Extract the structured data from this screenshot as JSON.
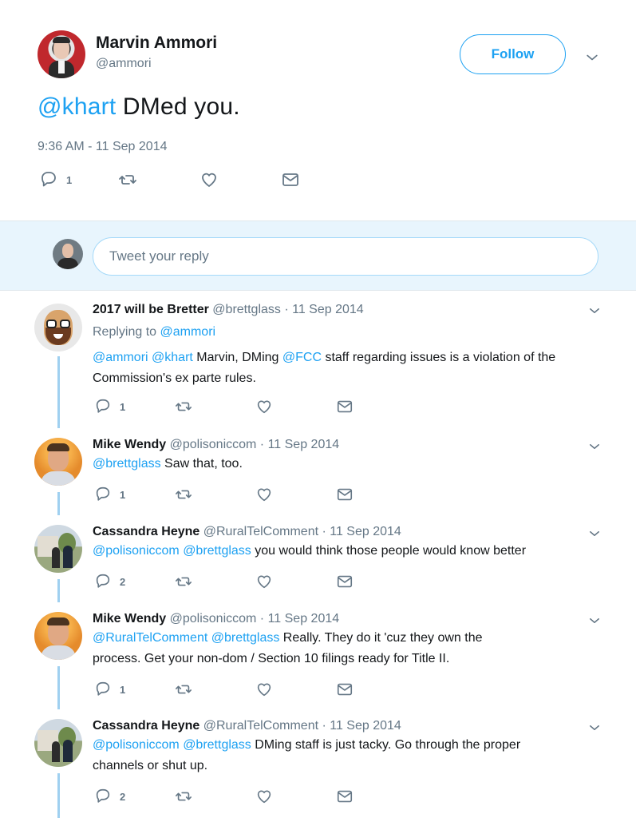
{
  "main_tweet": {
    "author_name": "Marvin Ammori",
    "author_handle": "@ammori",
    "follow_label": "Follow",
    "text_mention": "@khart",
    "text_rest": " DMed you.",
    "timestamp": "9:36 AM - 11 Sep 2014",
    "reply_count": "1"
  },
  "reply_box": {
    "placeholder": "Tweet your reply"
  },
  "colors": {
    "accent": "#1da1f2",
    "muted": "#657786",
    "reply_bg": "#e8f5fd",
    "thread_line": "#9fd0f0"
  },
  "icons": [
    "reply-icon",
    "retweet-icon",
    "like-icon",
    "dm-icon",
    "chevron-down-icon"
  ],
  "replies": [
    {
      "name": "2017 will be Bretter",
      "handle_date": "@brettglass · 11 Sep 2014",
      "replying_prefix": "Replying to ",
      "replying_to": "@ammori",
      "m1": "@ammori",
      "m2": "@khart",
      "t1": " Marvin, DMing ",
      "m3": "@FCC",
      "t2": " staff regarding issues is a violation of the",
      "line2": "Commission's ex parte rules.",
      "reply_count": "1"
    },
    {
      "name": "Mike Wendy",
      "handle_date": "@polisoniccom · 11 Sep 2014",
      "m1": "@brettglass",
      "t1": " Saw that, too.",
      "reply_count": "1"
    },
    {
      "name": "Cassandra Heyne",
      "handle_date": "@RuralTelComment · 11 Sep 2014",
      "m1": "@polisoniccom",
      "m2": "@brettglass",
      "t1": " you would think those people would know better",
      "reply_count": "2"
    },
    {
      "name": "Mike Wendy",
      "handle_date": "@polisoniccom · 11 Sep 2014",
      "m1": "@RuralTelComment",
      "m2": "@brettglass",
      "t1": " Really.  They do it 'cuz they own the",
      "line2": "process.  Get your non-dom / Section 10 filings ready for Title II.",
      "reply_count": "1"
    },
    {
      "name": "Cassandra Heyne",
      "handle_date": "@RuralTelComment · 11 Sep 2014",
      "m1": "@polisoniccom",
      "m2": "@brettglass",
      "t1": " DMing staff is just tacky. Go through the proper",
      "line2": "channels or shut up.",
      "reply_count": "2"
    }
  ]
}
